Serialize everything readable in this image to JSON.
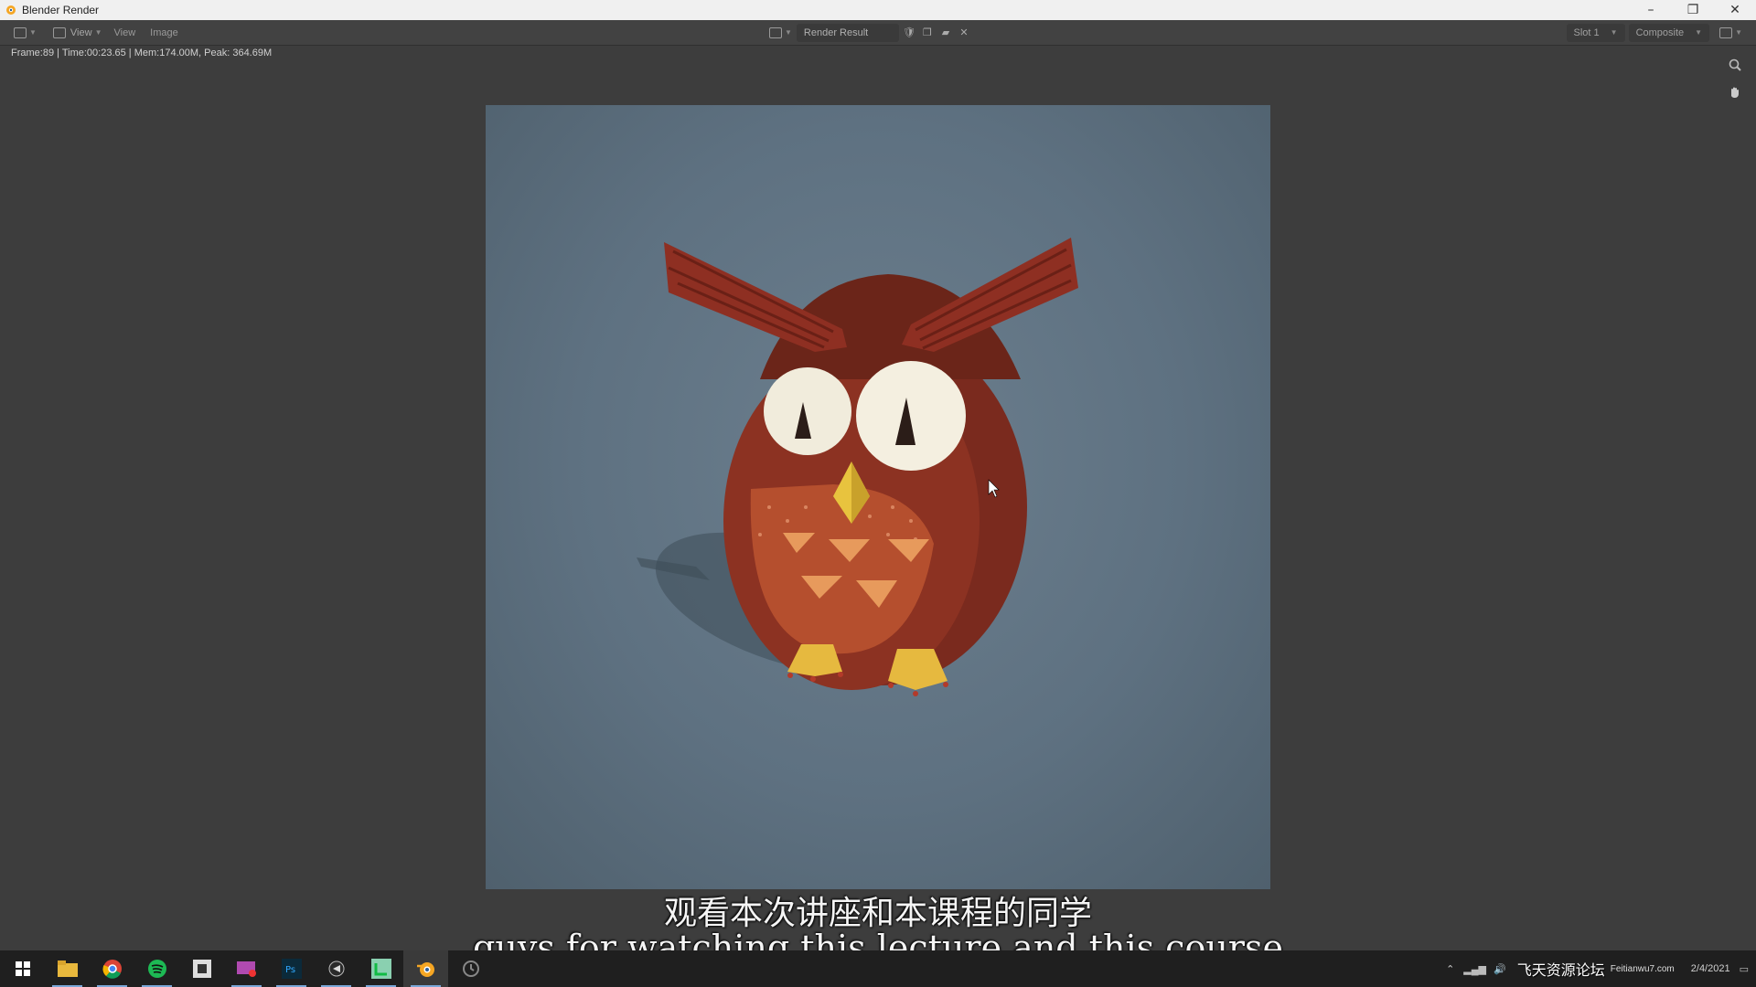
{
  "window": {
    "title": "Blender Render",
    "minimize": "–",
    "maximize": "❐",
    "close": "✕"
  },
  "header": {
    "view_dropdown": "View",
    "menu_view": "View",
    "menu_image": "Image",
    "image_name": "Render Result",
    "slot": "Slot 1",
    "pass": "Composite"
  },
  "stats": "Frame:89 | Time:00:23.65 | Mem:174.00M, Peak: 364.69M",
  "subtitles": {
    "chinese": "观看本次讲座和本课程的同学",
    "english": "guys for watching this lecture and this course"
  },
  "taskbar": {
    "apps": [
      "windows-start",
      "file-explorer",
      "chrome",
      "spotify",
      "app-square",
      "app-mail",
      "photoshop",
      "app-dark",
      "app-green",
      "blender",
      "app-circle"
    ],
    "active_app": "blender"
  },
  "tray": {
    "watermark": "飞天资源论坛",
    "watermark_small": "Feitianwu7.com",
    "date": "2/4/2021"
  },
  "colors": {
    "accent": "#f5a623",
    "background": "#3d3d3d",
    "render_bg": "#5e7181",
    "owl_body": "#8a3022",
    "owl_belly": "#b5502f"
  }
}
